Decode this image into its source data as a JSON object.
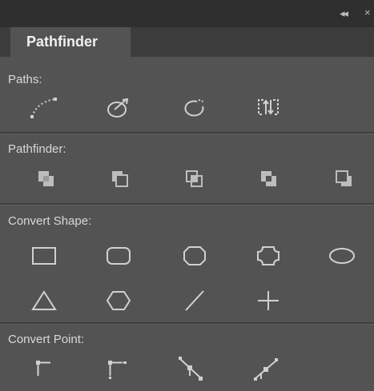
{
  "panel": {
    "collapse_glyph": "◂◂",
    "close_glyph": "×",
    "tab_label": "Pathfinder"
  },
  "sections": {
    "paths": {
      "label": "Paths:",
      "buttons": [
        "join-icon",
        "close-path-icon",
        "open-path-icon",
        "reverse-path-icon"
      ]
    },
    "pathfinder": {
      "label": "Pathfinder:",
      "buttons": [
        "add-icon",
        "subtract-icon",
        "intersect-icon",
        "exclude-overlap-icon",
        "minus-back-icon"
      ]
    },
    "convert_shape": {
      "label": "Convert Shape:",
      "buttons": [
        "rectangle-icon",
        "rounded-rectangle-icon",
        "beveled-rectangle-icon",
        "inverse-rounded-rectangle-icon",
        "ellipse-icon",
        "triangle-icon",
        "polygon-icon",
        "line-icon",
        "orthogonal-line-icon"
      ]
    },
    "convert_point": {
      "label": "Convert Point:",
      "buttons": [
        "plain-point-icon",
        "corner-point-icon",
        "smooth-point-icon",
        "symmetrical-point-icon"
      ]
    }
  },
  "colors": {
    "panel_bg": "#535353",
    "title_bg": "#2f2f2f",
    "tabbar_bg": "#3c3c3c",
    "icon": "#d0d0d0"
  }
}
